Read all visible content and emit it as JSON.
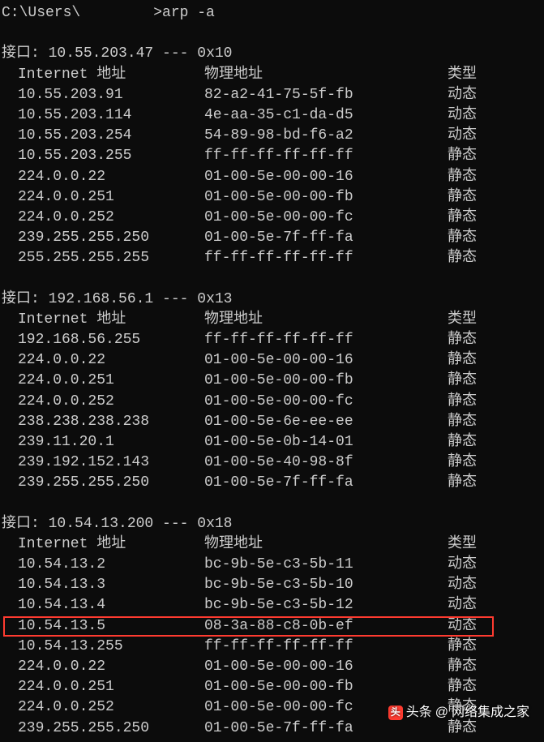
{
  "prompt": {
    "prefix": "C:\\Users\\",
    "suffix": ">",
    "command": "arp -a"
  },
  "headers": {
    "interface_label": "接口",
    "ip_header": "Internet 地址",
    "mac_header": "物理地址",
    "type_header": "类型"
  },
  "interfaces": [
    {
      "ip": "10.55.203.47",
      "sep": "---",
      "hexid": "0x10",
      "rows": [
        {
          "ip": "10.55.203.91",
          "mac": "82-a2-41-75-5f-fb",
          "type": "动态"
        },
        {
          "ip": "10.55.203.114",
          "mac": "4e-aa-35-c1-da-d5",
          "type": "动态"
        },
        {
          "ip": "10.55.203.254",
          "mac": "54-89-98-bd-f6-a2",
          "type": "动态"
        },
        {
          "ip": "10.55.203.255",
          "mac": "ff-ff-ff-ff-ff-ff",
          "type": "静态"
        },
        {
          "ip": "224.0.0.22",
          "mac": "01-00-5e-00-00-16",
          "type": "静态"
        },
        {
          "ip": "224.0.0.251",
          "mac": "01-00-5e-00-00-fb",
          "type": "静态"
        },
        {
          "ip": "224.0.0.252",
          "mac": "01-00-5e-00-00-fc",
          "type": "静态"
        },
        {
          "ip": "239.255.255.250",
          "mac": "01-00-5e-7f-ff-fa",
          "type": "静态"
        },
        {
          "ip": "255.255.255.255",
          "mac": "ff-ff-ff-ff-ff-ff",
          "type": "静态"
        }
      ]
    },
    {
      "ip": "192.168.56.1",
      "sep": "---",
      "hexid": "0x13",
      "rows": [
        {
          "ip": "192.168.56.255",
          "mac": "ff-ff-ff-ff-ff-ff",
          "type": "静态"
        },
        {
          "ip": "224.0.0.22",
          "mac": "01-00-5e-00-00-16",
          "type": "静态"
        },
        {
          "ip": "224.0.0.251",
          "mac": "01-00-5e-00-00-fb",
          "type": "静态"
        },
        {
          "ip": "224.0.0.252",
          "mac": "01-00-5e-00-00-fc",
          "type": "静态"
        },
        {
          "ip": "238.238.238.238",
          "mac": "01-00-5e-6e-ee-ee",
          "type": "静态"
        },
        {
          "ip": "239.11.20.1",
          "mac": "01-00-5e-0b-14-01",
          "type": "静态"
        },
        {
          "ip": "239.192.152.143",
          "mac": "01-00-5e-40-98-8f",
          "type": "静态"
        },
        {
          "ip": "239.255.255.250",
          "mac": "01-00-5e-7f-ff-fa",
          "type": "静态"
        }
      ]
    },
    {
      "ip": "10.54.13.200",
      "sep": "---",
      "hexid": "0x18",
      "rows": [
        {
          "ip": "10.54.13.2",
          "mac": "bc-9b-5e-c3-5b-11",
          "type": "动态"
        },
        {
          "ip": "10.54.13.3",
          "mac": "bc-9b-5e-c3-5b-10",
          "type": "动态"
        },
        {
          "ip": "10.54.13.4",
          "mac": "bc-9b-5e-c3-5b-12",
          "type": "动态"
        },
        {
          "ip": "10.54.13.5",
          "mac": "08-3a-88-c8-0b-ef",
          "type": "动态",
          "highlighted": true
        },
        {
          "ip": "10.54.13.255",
          "mac": "ff-ff-ff-ff-ff-ff",
          "type": "静态"
        },
        {
          "ip": "224.0.0.22",
          "mac": "01-00-5e-00-00-16",
          "type": "静态"
        },
        {
          "ip": "224.0.0.251",
          "mac": "01-00-5e-00-00-fb",
          "type": "静态"
        },
        {
          "ip": "224.0.0.252",
          "mac": "01-00-5e-00-00-fc",
          "type": "静态"
        },
        {
          "ip": "239.255.255.250",
          "mac": "01-00-5e-7f-ff-fa",
          "type": "静态"
        }
      ]
    }
  ],
  "watermark": {
    "prefix": "头条",
    "at": "@",
    "author": "网络集成之家"
  }
}
